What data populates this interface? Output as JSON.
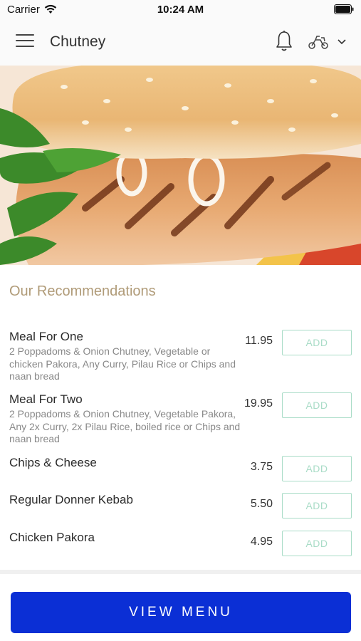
{
  "status_bar": {
    "carrier": "Carrier",
    "time": "10:24 AM"
  },
  "header": {
    "title": "Chutney",
    "icons": [
      "menu-icon",
      "bell-icon",
      "delivery-icon",
      "chevron-down-icon"
    ]
  },
  "hero": {
    "image": "grilled chicken burger"
  },
  "recommendations": {
    "title": "Our Recommendations",
    "add_label": "ADD",
    "items": [
      {
        "name": "Meal For One",
        "description": "2 Poppadoms & Onion Chutney, Vegetable or chicken Pakora, Any Curry, Pilau Rice or Chips and naan bread",
        "price": "11.95"
      },
      {
        "name": "Meal For Two",
        "description": "2 Poppadoms & Onion Chutney, Vegetable Pakora, Any 2x Curry, 2x Pilau Rice, boiled rice or Chips and naan bread",
        "price": "19.95"
      },
      {
        "name": "Chips & Cheese",
        "description": "",
        "price": "3.75"
      },
      {
        "name": "Regular Donner Kebab",
        "description": "",
        "price": "5.50"
      },
      {
        "name": "Chicken Pakora",
        "description": "",
        "price": "4.95"
      }
    ]
  },
  "footer": {
    "view_menu_label": "VIEW MENU"
  },
  "colors": {
    "accent_gold": "#b09b78",
    "add_border": "#a9dcc7",
    "primary_button": "#0b2fd5"
  }
}
